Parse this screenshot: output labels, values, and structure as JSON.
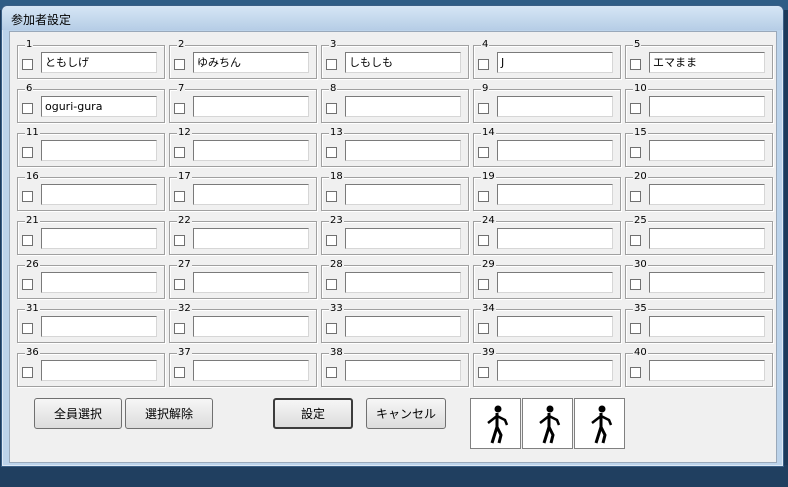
{
  "window": {
    "title": "参加者設定"
  },
  "participants": [
    {
      "num": "1",
      "name": "ともしげ"
    },
    {
      "num": "2",
      "name": "ゆみちん"
    },
    {
      "num": "3",
      "name": "しもしも"
    },
    {
      "num": "4",
      "name": "J"
    },
    {
      "num": "5",
      "name": "エマまま"
    },
    {
      "num": "6",
      "name": "oguri-gura"
    },
    {
      "num": "7",
      "name": ""
    },
    {
      "num": "8",
      "name": ""
    },
    {
      "num": "9",
      "name": ""
    },
    {
      "num": "10",
      "name": ""
    },
    {
      "num": "11",
      "name": ""
    },
    {
      "num": "12",
      "name": ""
    },
    {
      "num": "13",
      "name": ""
    },
    {
      "num": "14",
      "name": ""
    },
    {
      "num": "15",
      "name": ""
    },
    {
      "num": "16",
      "name": ""
    },
    {
      "num": "17",
      "name": ""
    },
    {
      "num": "18",
      "name": ""
    },
    {
      "num": "19",
      "name": ""
    },
    {
      "num": "20",
      "name": ""
    },
    {
      "num": "21",
      "name": ""
    },
    {
      "num": "22",
      "name": ""
    },
    {
      "num": "23",
      "name": ""
    },
    {
      "num": "24",
      "name": ""
    },
    {
      "num": "25",
      "name": ""
    },
    {
      "num": "26",
      "name": ""
    },
    {
      "num": "27",
      "name": ""
    },
    {
      "num": "28",
      "name": ""
    },
    {
      "num": "29",
      "name": ""
    },
    {
      "num": "30",
      "name": ""
    },
    {
      "num": "31",
      "name": ""
    },
    {
      "num": "32",
      "name": ""
    },
    {
      "num": "33",
      "name": ""
    },
    {
      "num": "34",
      "name": ""
    },
    {
      "num": "35",
      "name": ""
    },
    {
      "num": "36",
      "name": ""
    },
    {
      "num": "37",
      "name": ""
    },
    {
      "num": "38",
      "name": ""
    },
    {
      "num": "39",
      "name": ""
    },
    {
      "num": "40",
      "name": ""
    }
  ],
  "buttons": {
    "select_all": "全員選択",
    "deselect": "選択解除",
    "ok": "設定",
    "cancel": "キャンセル"
  },
  "figures": [
    {
      "icon": "stick-figure-icon"
    },
    {
      "icon": "stick-figure-icon"
    },
    {
      "icon": "stick-figure-icon"
    }
  ]
}
